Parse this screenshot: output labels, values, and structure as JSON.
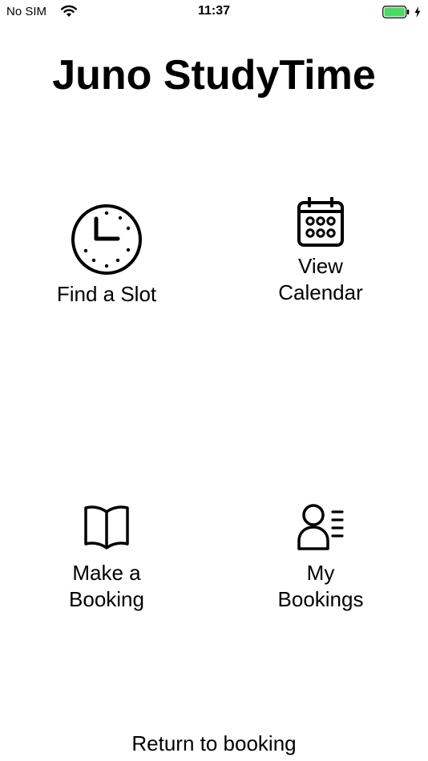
{
  "status_bar": {
    "carrier": "No SIM",
    "time": "11:37",
    "wifi_icon": "wifi-icon",
    "battery_icon": "battery-icon",
    "charging_icon": "charging-bolt-icon",
    "battery_color": "#4cd964"
  },
  "title": "Juno StudyTime",
  "menu": {
    "find_slot": {
      "label": "Find a Slot",
      "icon": "clock-icon"
    },
    "view_calendar": {
      "label": "View\nCalendar",
      "icon": "calendar-icon"
    },
    "make_booking": {
      "label": "Make a\nBooking",
      "icon": "book-icon"
    },
    "my_bookings": {
      "label": "My\nBookings",
      "icon": "user-list-icon"
    }
  },
  "footer": {
    "return_label": "Return to booking"
  }
}
